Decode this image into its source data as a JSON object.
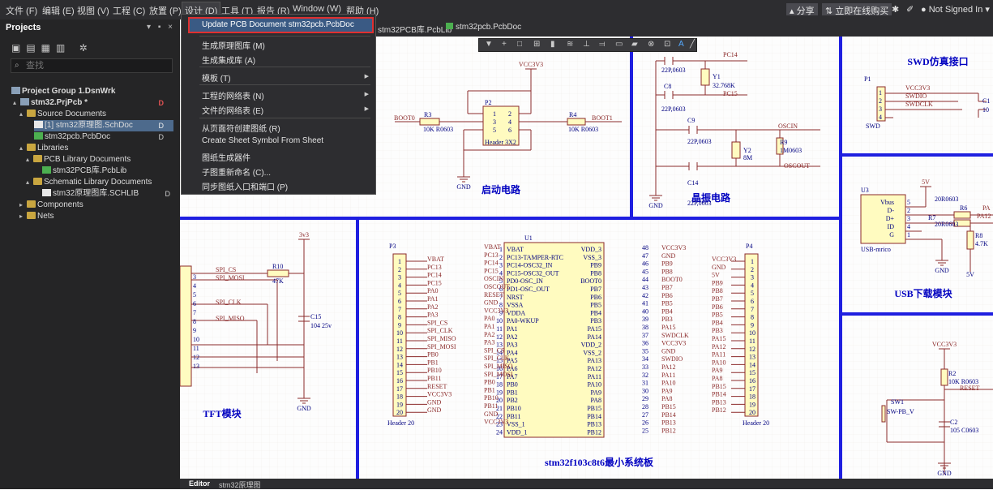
{
  "menu": [
    "文件 (F)",
    "编辑 (E)",
    "视图 (V)",
    "工程 (C)",
    "放置 (P)",
    "设计 (D)",
    "工具 (T)",
    "报告 (R)",
    "Window (W)",
    "帮助 (H)"
  ],
  "toolbar_right": {
    "share": "分享",
    "buy": "立即在线购买",
    "user": "Not Signed In"
  },
  "panel": {
    "title": "Projects",
    "search_placeholder": "查找",
    "tree": [
      {
        "label": "Project Group 1.DsnWrk"
      },
      {
        "label": "stm32.PrjPcb *"
      },
      {
        "label": "Source Documents"
      },
      {
        "label": "[1] stm32原理图.SchDoc"
      },
      {
        "label": "stm32pcb.PcbDoc"
      },
      {
        "label": "Libraries"
      },
      {
        "label": "PCB Library Documents"
      },
      {
        "label": "stm32PCB库.PcbLib"
      },
      {
        "label": "Schematic Library Documents"
      },
      {
        "label": "stm32原理图库.SCHLIB"
      },
      {
        "label": "Components"
      },
      {
        "label": "Nets"
      }
    ]
  },
  "dropdown": [
    {
      "label": "Update PCB Document stm32pcb.PcbDoc"
    },
    {
      "label": "生成原理图库 (M)"
    },
    {
      "label": "生成集成库 (A)"
    },
    {
      "label": "模板 (T)"
    },
    {
      "label": "工程的网络表 (N)"
    },
    {
      "label": "文件的网络表 (E)"
    },
    {
      "label": "从页面符创建图纸 (R)"
    },
    {
      "label": "Create Sheet Symbol From Sheet"
    },
    {
      "label": "图纸生成器件"
    },
    {
      "label": "子图重新命名 (C)..."
    },
    {
      "label": "同步图纸入口和端口 (P)"
    }
  ],
  "tabs": [
    "stm32PCB库.PcbLib",
    "stm32pcb.PcbDoc"
  ],
  "schematic": {
    "section_titles": [
      "启动电路",
      "晶振电路",
      "SWD仿真接口",
      "TFT模块",
      "stm32f103c8t6最小系统板",
      "USB下载模块"
    ],
    "boot": {
      "vcc": "VCC3V3",
      "r3": "R3",
      "r3v": "10K R0603",
      "r4": "R4",
      "r4v": "10K R0603",
      "boot0": "BOOT0",
      "boot1": "BOOT1",
      "p2": "P2",
      "p2name": "Header 3X2",
      "pins": [
        "1",
        "2",
        "3",
        "4",
        "5",
        "6"
      ],
      "gnd": "GND"
    },
    "crystal": {
      "c7v": "22P,0603",
      "c8": "C8",
      "c8v": "22P,0603",
      "y1": "Y1",
      "y1v": "32.768K",
      "pc14": "PC14",
      "pc15": "PC15",
      "c9": "C9",
      "c9v": "22P,0603",
      "c14": "C14",
      "c14v": "22P,0603",
      "y2": "Y2",
      "y2v": "8M",
      "r9": "R9",
      "r9v": "1M0603",
      "oscin": "OSCIN",
      "oscout": "OSCOUT",
      "gnd": "GND"
    },
    "swd": {
      "p1": "P1",
      "nets": [
        "VCC3V3",
        "SWDIO",
        "SWDCLK"
      ],
      "pins": [
        "1",
        "2",
        "3",
        "4"
      ],
      "name": "SWD",
      "c": "C1",
      "cv": "10"
    },
    "tft": {
      "vcc": "3v3",
      "r10": "R10",
      "r10v": "47K",
      "nets": [
        "SPI_CS",
        "SPI_MOSI",
        "SPI_CLK",
        "SPI_MISO"
      ],
      "c15": "C15",
      "c15v": "104 25v",
      "gnd": "GND",
      "pins": [
        "3",
        "4",
        "5",
        "6",
        "7",
        "8",
        "9",
        "10",
        "11",
        "12",
        "13"
      ]
    },
    "p3": {
      "ref": "P3",
      "name": "Header 20",
      "nets": [
        "VBAT",
        "PC13",
        "PC14",
        "PC15",
        "PA0",
        "PA1",
        "PA2",
        "PA3",
        "SPI_CS",
        "SPI_CLK",
        "SPI_MISO",
        "SPI_MOSI",
        "PB0",
        "PB1",
        "PB10",
        "PB11",
        "RESET",
        "VCC3V3",
        "GND",
        "GND"
      ]
    },
    "u1": {
      "ref": "U1",
      "left_nets": [
        "VBAT",
        "PC13",
        "PC14",
        "PC15",
        "OSCIN",
        "OSCOUT",
        "RESET",
        "GND",
        "VCC3V3",
        "PA0",
        "PA1",
        "PA2",
        "PA3",
        "SPI_CS",
        "SPI_CLK",
        "SPI_MISO",
        "SPI_MOSI",
        "PB0",
        "PB1",
        "PB10",
        "PB11",
        "GND",
        "VCC3V3"
      ],
      "left_pins": [
        "1",
        "2",
        "3",
        "4",
        "5",
        "6",
        "7",
        "8",
        "9",
        "10",
        "11",
        "12",
        "13",
        "14",
        "15",
        "16",
        "17",
        "18",
        "19",
        "20",
        "21",
        "22",
        "23",
        "24"
      ],
      "left_names": [
        "VBAT",
        "PC13-TAMPER-RTC",
        "PC14-OSC32_IN",
        "PC15-OSC32_OUT",
        "PD0-OSC_IN",
        "PD1-OSC_OUT",
        "NRST",
        "VSSA",
        "VDDA",
        "PA0-WKUP",
        "PA1",
        "PA2",
        "PA3",
        "PA4",
        "PA5",
        "PA6",
        "PA7",
        "PB0",
        "PB1",
        "PB2",
        "PB10",
        "PB11",
        "VSS_1",
        "VDD_1"
      ],
      "right_names": [
        "VDD_3",
        "VSS_3",
        "PB9",
        "PB8",
        "BOOT0",
        "PB7",
        "PB6",
        "PB5",
        "PB4",
        "PB3",
        "PA15",
        "PA14",
        "VDD_2",
        "VSS_2",
        "PA13",
        "PA12",
        "PA11",
        "PA10",
        "PA9",
        "PA8",
        "PB15",
        "PB14",
        "PB13",
        "PB12"
      ],
      "right_pins": [
        "48",
        "47",
        "46",
        "45",
        "44",
        "43",
        "42",
        "41",
        "40",
        "39",
        "38",
        "37",
        "36",
        "35",
        "34",
        "33",
        "32",
        "31",
        "30",
        "29",
        "28",
        "27",
        "26",
        "25"
      ],
      "right_nets": [
        "VCC3V3",
        "GND",
        "PB9",
        "PB8",
        "BOOT0",
        "PB7",
        "PB6",
        "PB5",
        "PB4",
        "PB3",
        "PA15",
        "SWDCLK",
        "VCC3V3",
        "GND",
        "SWDIO",
        "PA12",
        "PA11",
        "PA10",
        "PA9",
        "PA8",
        "PB15",
        "PB14",
        "PB13",
        "PB12"
      ]
    },
    "p4": {
      "ref": "P4",
      "name": "Header 20",
      "nets": [
        "VCC3V3",
        "GND",
        "5V",
        "PB9",
        "PB8",
        "PB7",
        "PB6",
        "PB5",
        "PB4",
        "PB3",
        "PA15",
        "PA12",
        "PA11",
        "PA10",
        "PA9",
        "PA8",
        "PB15",
        "PB14",
        "PB13",
        "PB12"
      ]
    },
    "usb": {
      "ref": "U3",
      "v5": "5V",
      "pins": [
        "Vbus",
        "D-",
        "D+",
        "ID",
        "G"
      ],
      "pin_nums": [
        "5",
        "2",
        "3",
        "4",
        "1"
      ],
      "r6": "R6",
      "r6v": "20R0603",
      "r7": "R7",
      "r7v": "20R0603",
      "pa": "PA",
      "pa12": "PA12",
      "r8": "R8",
      "r8v": "4.7K",
      "name": "USB-mrico",
      "gnd": "GND",
      "bottom5v": "5V"
    },
    "reset": {
      "vcc": "VCC3V3",
      "r2": "R2",
      "r2v": "10K R0603",
      "net": "RESET",
      "sw": "SW1",
      "swv": "SW-PB_V",
      "c2": "C2",
      "c2v": "105 C0603",
      "gnd": "GND"
    }
  },
  "bottom_tabs": [
    "Editor",
    "stm32原理图"
  ]
}
